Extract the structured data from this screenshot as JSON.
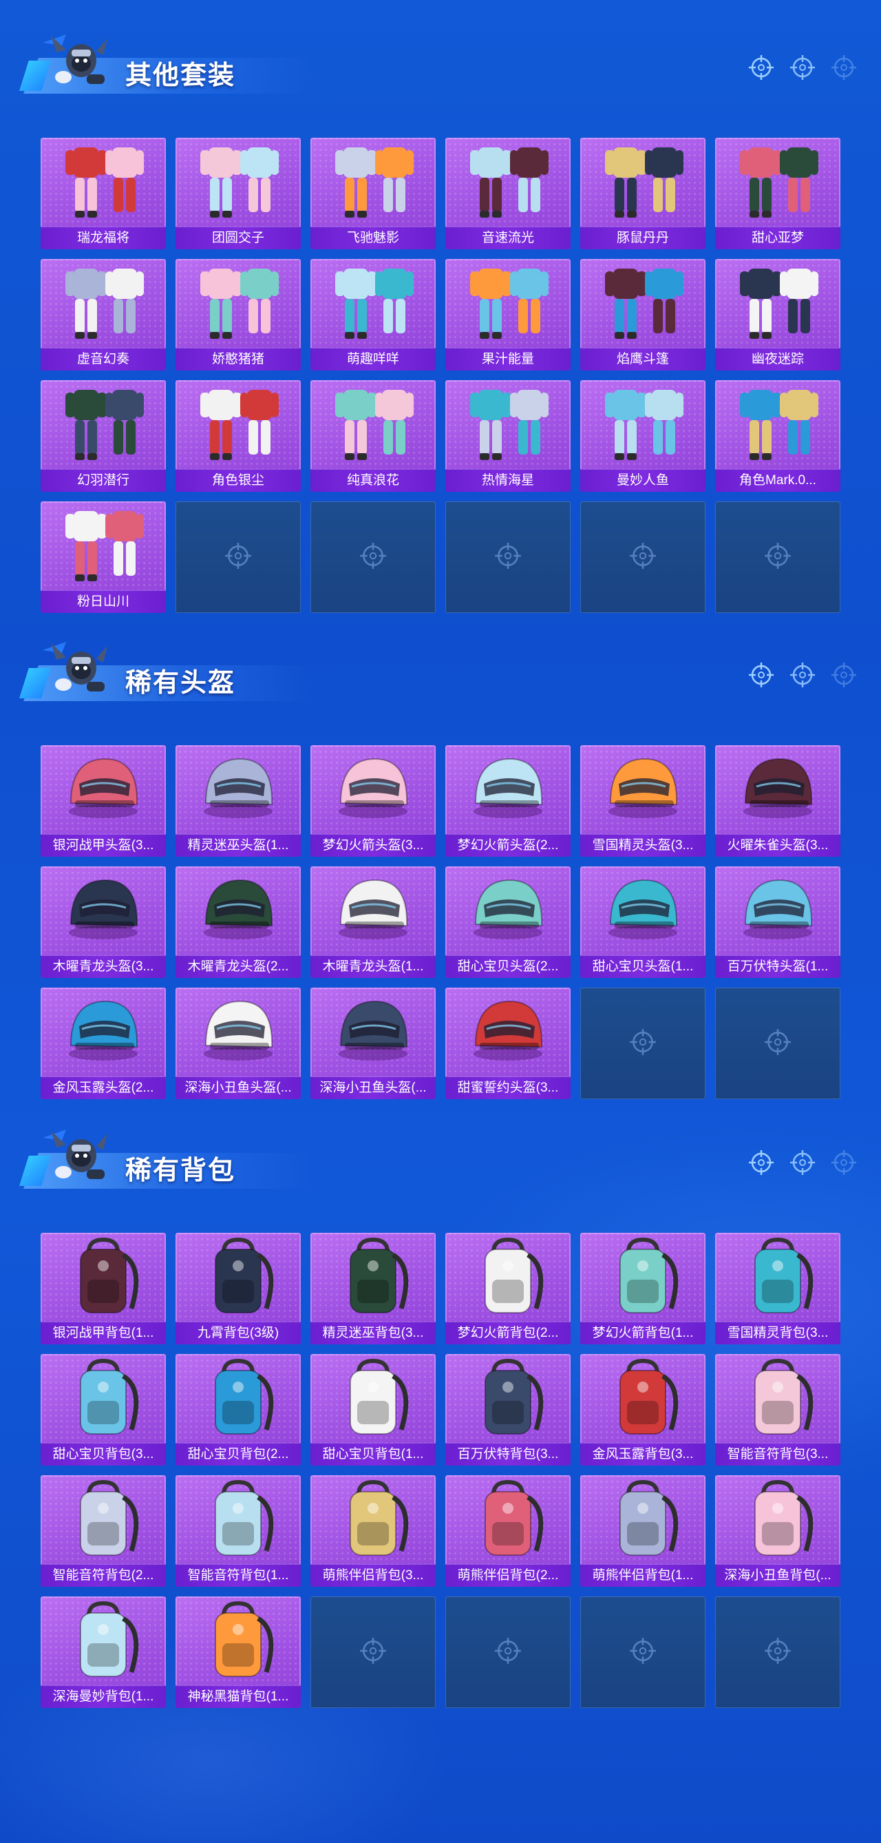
{
  "theme": {
    "accent": "#1159d6",
    "card_purple": "#a254e4",
    "label_purple": "#7f2ce0",
    "empty_slot": "#1d4d8f"
  },
  "sections": [
    {
      "title": "其他套装",
      "kind": "outfit",
      "items": [
        "瑞龙福将",
        "团圆交子",
        "飞驰魅影",
        "音速流光",
        "豚鼠丹丹",
        "甜心亚梦",
        "虚音幻奏",
        "娇憨猪猪",
        "萌趣咩咩",
        "果汁能量",
        "焰鹰斗篷",
        "幽夜迷踪",
        "幻羽潜行",
        "角色银尘",
        "纯真浪花",
        "热情海星",
        "曼妙人鱼",
        "角色Mark.0...",
        "粉日山川"
      ],
      "empty_slots": 5
    },
    {
      "title": "稀有头盔",
      "kind": "helmet",
      "items": [
        "银河战甲头盔(3...",
        "精灵迷巫头盔(1...",
        "梦幻火箭头盔(3...",
        "梦幻火箭头盔(2...",
        "雪国精灵头盔(3...",
        "火曜朱雀头盔(3...",
        "木曜青龙头盔(3...",
        "木曜青龙头盔(2...",
        "木曜青龙头盔(1...",
        "甜心宝贝头盔(2...",
        "甜心宝贝头盔(1...",
        "百万伏特头盔(1...",
        "金风玉露头盔(2...",
        "深海小丑鱼头盔(...",
        "深海小丑鱼头盔(...",
        "甜蜜誓约头盔(3..."
      ],
      "empty_slots": 2
    },
    {
      "title": "稀有背包",
      "kind": "backpack",
      "items": [
        "银河战甲背包(1...",
        "九霄背包(3级)",
        "精灵迷巫背包(3...",
        "梦幻火箭背包(2...",
        "梦幻火箭背包(1...",
        "雪国精灵背包(3...",
        "甜心宝贝背包(3...",
        "甜心宝贝背包(2...",
        "甜心宝贝背包(1...",
        "百万伏特背包(3...",
        "金风玉露背包(3...",
        "智能音符背包(3...",
        "智能音符背包(2...",
        "智能音符背包(1...",
        "萌熊伴侣背包(3...",
        "萌熊伴侣背包(2...",
        "萌熊伴侣背包(1...",
        "深海小丑鱼背包(...",
        "深海曼妙背包(1...",
        "神秘黑猫背包(1..."
      ],
      "empty_slots": 4
    }
  ]
}
